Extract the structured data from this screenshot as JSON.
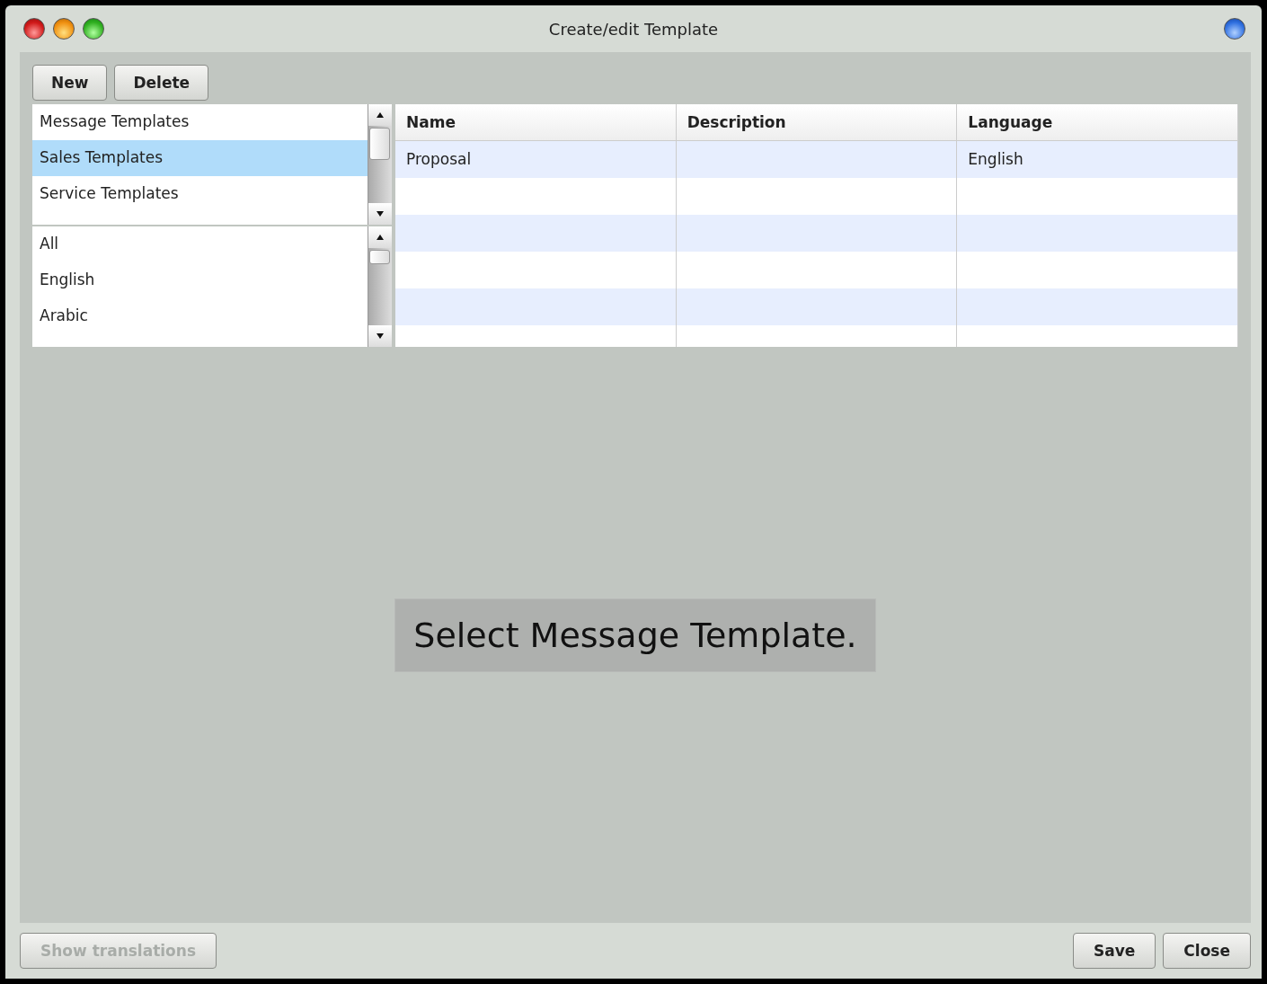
{
  "window": {
    "title": "Create/edit Template"
  },
  "toolbar": [
    {
      "label": "New"
    },
    {
      "label": "Delete"
    }
  ],
  "category_list": [
    {
      "label": "Message Templates",
      "selected": false
    },
    {
      "label": "Sales Templates",
      "selected": true
    },
    {
      "label": "Service Templates",
      "selected": false
    }
  ],
  "language_list": [
    {
      "label": "All",
      "selected": false
    },
    {
      "label": "English",
      "selected": false
    },
    {
      "label": "Arabic",
      "selected": false
    }
  ],
  "table": {
    "columns": [
      "Name",
      "Description",
      "Language"
    ],
    "rows": [
      [
        "Proposal",
        "",
        "English"
      ]
    ]
  },
  "message": "Select Message Template.",
  "footer": {
    "left": [
      {
        "label": "Show translations",
        "disabled": true
      }
    ],
    "right": [
      {
        "label": "Save",
        "disabled": false
      },
      {
        "label": "Close",
        "disabled": false
      }
    ]
  }
}
